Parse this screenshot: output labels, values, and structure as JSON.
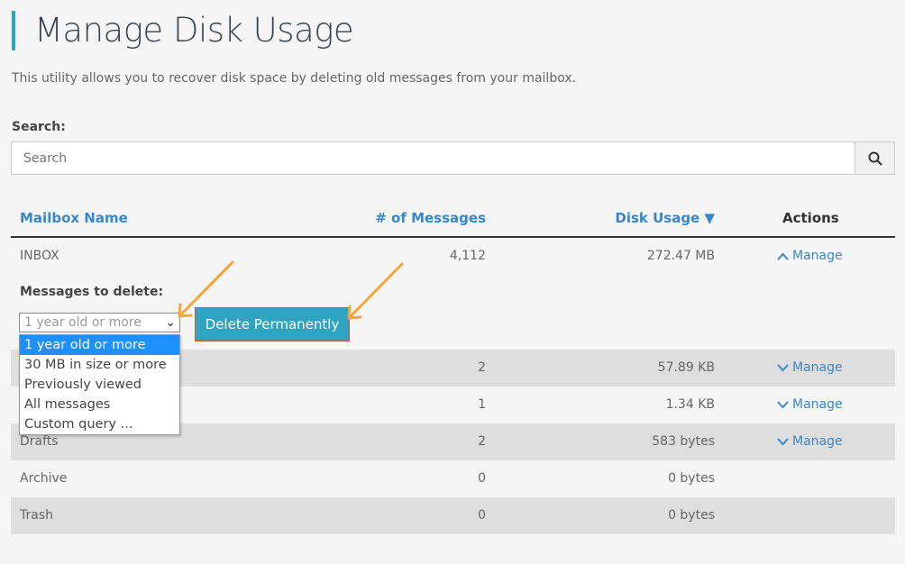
{
  "page": {
    "title": "Manage Disk Usage",
    "description": "This utility allows you to recover disk space by deleting old messages from your mailbox."
  },
  "search": {
    "label": "Search:",
    "placeholder": "Search",
    "icon": "search-icon"
  },
  "table": {
    "headers": [
      "Mailbox Name",
      "# of Messages",
      "Disk Usage ▼",
      "Actions"
    ],
    "rows": [
      {
        "name": "INBOX",
        "messages": "4,112",
        "usage": "272.47 MB",
        "action": "Manage",
        "expanded": true
      },
      {
        "name": "",
        "messages": "2",
        "usage": "57.89 KB",
        "action": "Manage"
      },
      {
        "name": "",
        "messages": "1",
        "usage": "1.34 KB",
        "action": "Manage"
      },
      {
        "name": "Drafts",
        "messages": "2",
        "usage": "583 bytes",
        "action": "Manage"
      },
      {
        "name": "Archive",
        "messages": "0",
        "usage": "0 bytes",
        "action": ""
      },
      {
        "name": "Trash",
        "messages": "0",
        "usage": "0 bytes",
        "action": ""
      }
    ]
  },
  "delete": {
    "label": "Messages to delete:",
    "selected": "1 year old or more",
    "options": [
      "1 year old or more",
      "30 MB in size or more",
      "Previously viewed",
      "All messages",
      "Custom query ..."
    ],
    "button": "Delete Permanently"
  },
  "colors": {
    "accent": "#2fa4c0",
    "link": "#3a87c8",
    "annotation_arrow": "#f5a63a",
    "selected_option": "#1e90ff"
  }
}
